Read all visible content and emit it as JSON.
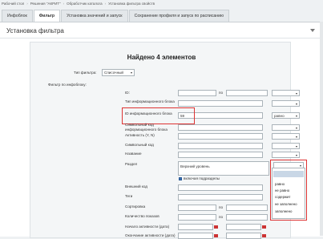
{
  "breadcrumb": [
    "Рабочий стол",
    "Решения \"АКРИТ\"",
    "Обработчик каталога",
    "Установка фильтра свойств"
  ],
  "tabs": [
    {
      "label": "Инфоблок",
      "active": false
    },
    {
      "label": "Фильтр",
      "active": true
    },
    {
      "label": "Установка значений и запуск",
      "active": false
    },
    {
      "label": "Сохранение профиля и запуск по расписанию",
      "active": false
    }
  ],
  "panel": {
    "title": "Установка фильтра"
  },
  "found_text": "Найдено 4 элементов",
  "filter_type": {
    "label": "Тип фильтра:",
    "value": "Списочный"
  },
  "iblock_filter_label": "Фильтр по инфоблоку:",
  "fields": {
    "id": {
      "label": "ID:",
      "to": "по"
    },
    "iblock_type": {
      "label": "Тип информационного блока"
    },
    "iblock_id": {
      "label": "ID информационного блока",
      "value": "59",
      "operator": "равно"
    },
    "code": {
      "label": "Символьный код информационного блока"
    },
    "active": {
      "label": "Активность (Y, N)"
    },
    "sym_code": {
      "label": "Символьный код"
    },
    "name": {
      "label": "Название"
    },
    "section": {
      "label": "Раздел",
      "value": "Верхний уровень",
      "include_sub": "включая подразделы"
    },
    "ext_code": {
      "label": "Внешний код"
    },
    "tags": {
      "label": "Теги"
    },
    "sort": {
      "label": "Сортировка",
      "to": "по"
    },
    "shows": {
      "label": "Количество показов",
      "to": "по"
    },
    "active_from": {
      "label": "Начало активности (дата)"
    },
    "active_to": {
      "label": "Окончание активности (дата)"
    }
  },
  "dropdown_options": [
    "равно",
    "не равно",
    "содержит",
    "не заполнено",
    "заполнено"
  ],
  "colors": {
    "highlight": "#dd3333",
    "checkbox": "#3a6fb0"
  }
}
